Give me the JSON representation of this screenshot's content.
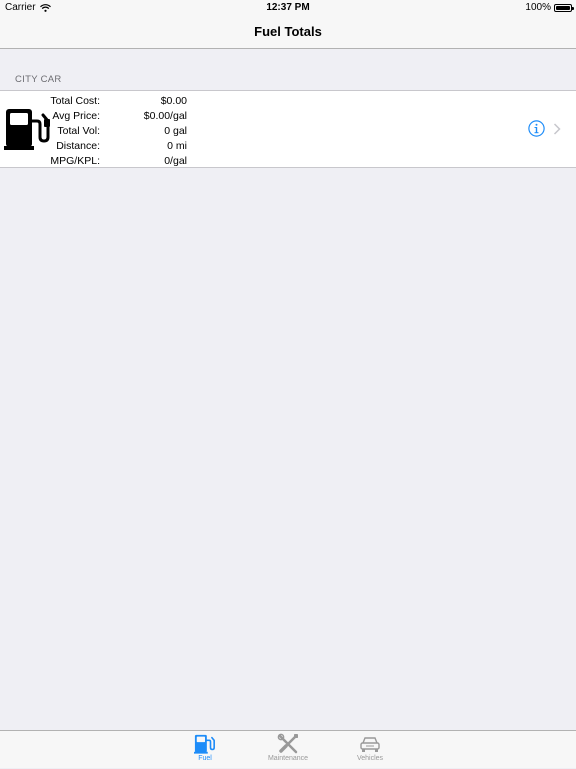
{
  "status_bar": {
    "carrier": "Carrier",
    "time": "12:37 PM",
    "battery": "100%",
    "battery_level": 1.0,
    "wifi_icon": "wifi-icon",
    "battery_icon": "battery-icon"
  },
  "nav": {
    "title": "Fuel Totals"
  },
  "section": {
    "header": "CITY CAR",
    "stats": [
      {
        "label": "Total Cost:",
        "value": "$0.00"
      },
      {
        "label": "Avg Price:",
        "value": "$0.00/gal"
      },
      {
        "label": "Total Vol:",
        "value": "0 gal"
      },
      {
        "label": "Distance:",
        "value": "0 mi"
      },
      {
        "label": "MPG/KPL:",
        "value": "0/gal"
      }
    ],
    "icon": "fuel-pump-icon"
  },
  "tabs": [
    {
      "label": "Fuel",
      "icon": "fuel-pump-icon",
      "selected": true
    },
    {
      "label": "Maintenance",
      "icon": "wrench-screwdriver-icon",
      "selected": false
    },
    {
      "label": "Vehicles",
      "icon": "car-icon",
      "selected": false
    }
  ],
  "colors": {
    "accent": "#1d8cf8",
    "inactive": "#999999",
    "background": "#efeff4"
  }
}
